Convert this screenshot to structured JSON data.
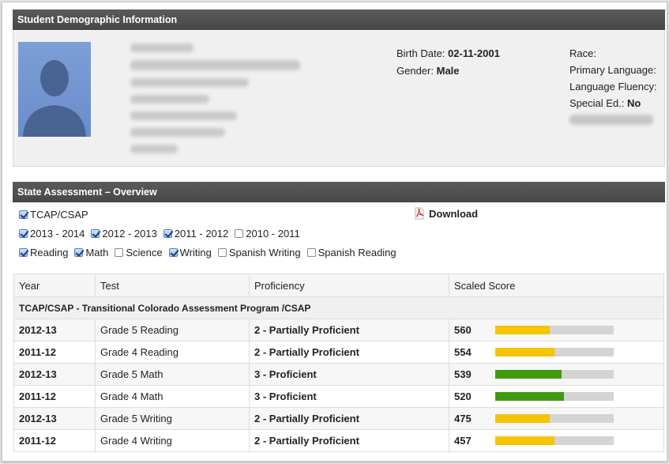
{
  "demographic": {
    "header": "Student Demographic Information",
    "birth_date_label": "Birth Date:",
    "birth_date": "02-11-2001",
    "gender_label": "Gender:",
    "gender": "Male",
    "race_label": "Race:",
    "primary_language_label": "Primary Language:",
    "language_fluency_label": "Language Fluency:",
    "special_ed_label": "Special Ed.:",
    "special_ed": "No"
  },
  "assessment": {
    "header": "State Assessment – Overview",
    "download_label": "Download",
    "test_filter": [
      {
        "label": "TCAP/CSAP",
        "checked": true
      }
    ],
    "year_filters": [
      {
        "label": "2013 - 2014",
        "checked": true
      },
      {
        "label": "2012 - 2013",
        "checked": true
      },
      {
        "label": "2011 - 2012",
        "checked": true
      },
      {
        "label": "2010 - 2011",
        "checked": false
      }
    ],
    "subject_filters": [
      {
        "label": "Reading",
        "checked": true
      },
      {
        "label": "Math",
        "checked": true
      },
      {
        "label": "Science",
        "checked": false
      },
      {
        "label": "Writing",
        "checked": true
      },
      {
        "label": "Spanish Writing",
        "checked": false
      },
      {
        "label": "Spanish Reading",
        "checked": false
      }
    ],
    "columns": [
      "Year",
      "Test",
      "Proficiency",
      "Scaled Score"
    ],
    "group_title": "TCAP/CSAP - Transitional Colorado Assessment Program /CSAP",
    "colors": {
      "partial": "#f6c400",
      "proficient": "#3f9a0f"
    },
    "rows": [
      {
        "year": "2012-13",
        "test": "Grade 5 Reading",
        "proficiency": "2 - Partially Proficient",
        "score": "560",
        "level": "partial",
        "fill": 0.46
      },
      {
        "year": "2011-12",
        "test": "Grade 4 Reading",
        "proficiency": "2 - Partially Proficient",
        "score": "554",
        "level": "partial",
        "fill": 0.5
      },
      {
        "year": "2012-13",
        "test": "Grade 5 Math",
        "proficiency": "3 - Proficient",
        "score": "539",
        "level": "proficient",
        "fill": 0.56
      },
      {
        "year": "2011-12",
        "test": "Grade 4 Math",
        "proficiency": "3 - Proficient",
        "score": "520",
        "level": "proficient",
        "fill": 0.58
      },
      {
        "year": "2012-13",
        "test": "Grade 5 Writing",
        "proficiency": "2 - Partially Proficient",
        "score": "475",
        "level": "partial",
        "fill": 0.46
      },
      {
        "year": "2011-12",
        "test": "Grade 4 Writing",
        "proficiency": "2 - Partially Proficient",
        "score": "457",
        "level": "partial",
        "fill": 0.5
      }
    ]
  }
}
